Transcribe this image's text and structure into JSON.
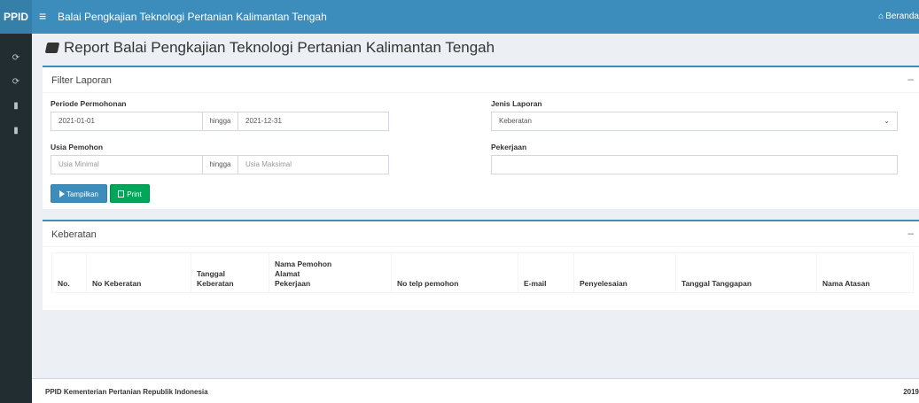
{
  "topbar": {
    "brand": "PPID",
    "menu_icon": "hamburger-icon",
    "title": "Balai Pengkajian Teknologi Pertanian Kalimantan Tengah",
    "home_icon": "home-icon",
    "home_label": "Beranda"
  },
  "sidebar": {
    "items": [
      {
        "icon": "rotate-icon"
      },
      {
        "icon": "rotate-icon"
      },
      {
        "icon": "book-icon"
      },
      {
        "icon": "book-icon"
      }
    ]
  },
  "page": {
    "title": "Report Balai Pengkajian Teknologi Pertanian Kalimantan Tengah"
  },
  "filter": {
    "box_title": "Filter Laporan",
    "collapse_icon": "minus-icon",
    "periode_label": "Periode Permohonan",
    "periode_from": "2021-01-01",
    "hingga": "hingga",
    "periode_to": "2021-12-31",
    "usia_label": "Usia Pemohon",
    "usia_min_placeholder": "Usia Minimal",
    "usia_max_placeholder": "Usia Maksimal",
    "jenis_label": "Jenis Laporan",
    "jenis_value": "Keberatan",
    "pekerjaan_label": "Pekerjaan",
    "pekerjaan_value": "",
    "tampilkan_label": "Tampilkan",
    "print_label": "Print"
  },
  "keberatan": {
    "box_title": "Keberatan",
    "collapse_icon": "minus-icon",
    "columns": [
      {
        "label": "No."
      },
      {
        "label": "No Keberatan"
      },
      {
        "line1": "Tanggal",
        "line2": "Keberatan"
      },
      {
        "line1": "Nama Pemohon",
        "line2": "Alamat",
        "line3": "Pekerjaan"
      },
      {
        "label": "No telp pemohon"
      },
      {
        "label": "E-mail"
      },
      {
        "label": "Penyelesaian"
      },
      {
        "label": "Tanggal Tanggapan"
      },
      {
        "label": "Nama Atasan"
      }
    ]
  },
  "footer": {
    "left": "PPID Kementerian Pertanian Republik Indonesia",
    "right": "2019"
  },
  "colors": {
    "primary": "#3c8dbc",
    "success": "#00a65a",
    "sidebar": "#222d32"
  }
}
